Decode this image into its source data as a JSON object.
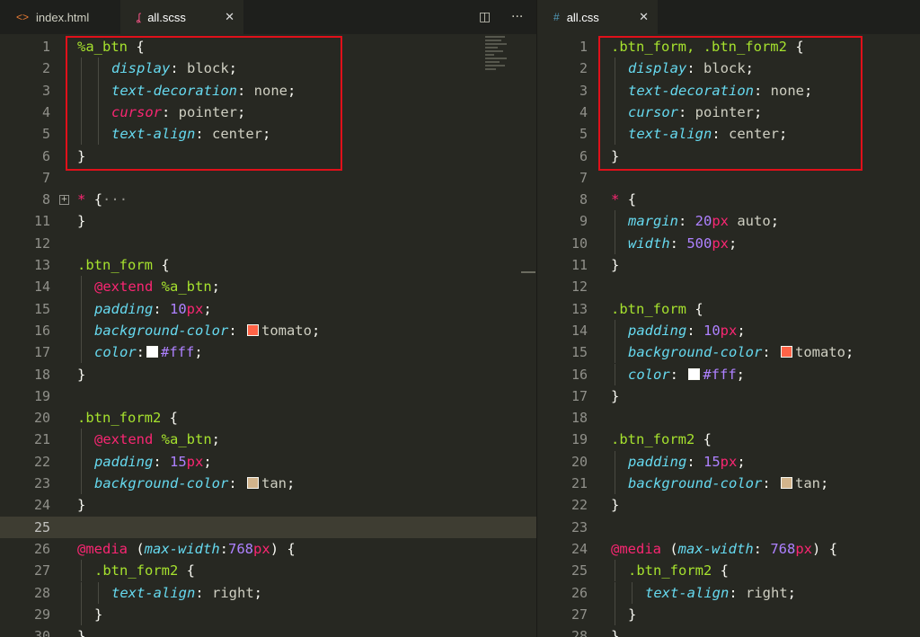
{
  "tabs": {
    "left": [
      {
        "label": "index.html",
        "icon": "html-icon",
        "icon_glyph": "<>",
        "icon_color": "#e37933"
      },
      {
        "label": "all.scss",
        "icon": "sass-icon",
        "icon_glyph": "ʆ",
        "icon_color": "#f55385",
        "close": "✕"
      }
    ],
    "right": [
      {
        "label": "all.css",
        "icon": "css-icon",
        "icon_glyph": "#",
        "icon_color": "#519aba",
        "close": "✕"
      }
    ],
    "split_button": "◫",
    "more_button": "···"
  },
  "colors": {
    "background": "#272822",
    "tomato": "#ff6347",
    "white": "#ffffff",
    "tan": "#d2b48c",
    "highlight_box": "#e0101a"
  },
  "left_lines": [
    {
      "n": "1",
      "parts": [
        [
          "sel",
          "%a_btn"
        ],
        [
          "pun",
          " "
        ],
        [
          "brace",
          "{"
        ]
      ]
    },
    {
      "n": "2",
      "indent": 2,
      "parts": [
        [
          "pr",
          "display"
        ],
        [
          "pun",
          ": "
        ],
        [
          "val",
          "block"
        ],
        [
          "pun",
          ";"
        ]
      ]
    },
    {
      "n": "3",
      "indent": 2,
      "parts": [
        [
          "pr",
          "text-decoration"
        ],
        [
          "pun",
          ": "
        ],
        [
          "val",
          "none"
        ],
        [
          "pun",
          ";"
        ]
      ]
    },
    {
      "n": "4",
      "indent": 2,
      "parts": [
        [
          "prr",
          "cursor"
        ],
        [
          "pun",
          ": "
        ],
        [
          "val",
          "pointer"
        ],
        [
          "pun",
          ";"
        ]
      ]
    },
    {
      "n": "5",
      "indent": 2,
      "parts": [
        [
          "pr",
          "text-align"
        ],
        [
          "pun",
          ": "
        ],
        [
          "val",
          "center"
        ],
        [
          "pun",
          ";"
        ]
      ]
    },
    {
      "n": "6",
      "parts": [
        [
          "brace",
          "}"
        ]
      ]
    },
    {
      "n": "7",
      "parts": []
    },
    {
      "n": "8",
      "fold": "+",
      "parts": [
        [
          "star",
          "*"
        ],
        [
          "pun",
          " "
        ],
        [
          "brace",
          "{"
        ],
        [
          "dots",
          "···"
        ]
      ]
    },
    {
      "n": "11",
      "parts": [
        [
          "brace",
          "}"
        ]
      ]
    },
    {
      "n": "12",
      "parts": []
    },
    {
      "n": "13",
      "parts": [
        [
          "sel",
          ".btn_form"
        ],
        [
          "pun",
          " "
        ],
        [
          "brace",
          "{"
        ]
      ]
    },
    {
      "n": "14",
      "indent": 1,
      "parts": [
        [
          "at",
          "@extend"
        ],
        [
          "pun",
          " "
        ],
        [
          "sel",
          "%a_btn"
        ],
        [
          "pun",
          ";"
        ]
      ]
    },
    {
      "n": "15",
      "indent": 1,
      "parts": [
        [
          "pr",
          "padding"
        ],
        [
          "pun",
          ": "
        ],
        [
          "num",
          "10"
        ],
        [
          "unit",
          "px"
        ],
        [
          "pun",
          ";"
        ]
      ]
    },
    {
      "n": "16",
      "indent": 1,
      "parts": [
        [
          "pr",
          "background-color"
        ],
        [
          "pun",
          ": "
        ],
        [
          "swatch",
          "#ff6347"
        ],
        [
          "val",
          "tomato"
        ],
        [
          "pun",
          ";"
        ]
      ]
    },
    {
      "n": "17",
      "indent": 1,
      "parts": [
        [
          "pr",
          "color"
        ],
        [
          "pun",
          ":"
        ],
        [
          "swatch",
          "#ffffff"
        ],
        [
          "num",
          "#fff"
        ],
        [
          "pun",
          ";"
        ]
      ]
    },
    {
      "n": "18",
      "parts": [
        [
          "brace",
          "}"
        ]
      ]
    },
    {
      "n": "19",
      "parts": []
    },
    {
      "n": "20",
      "parts": [
        [
          "sel",
          ".btn_form2"
        ],
        [
          "pun",
          " "
        ],
        [
          "brace",
          "{"
        ]
      ]
    },
    {
      "n": "21",
      "indent": 1,
      "parts": [
        [
          "at",
          "@extend"
        ],
        [
          "pun",
          " "
        ],
        [
          "sel",
          "%a_btn"
        ],
        [
          "pun",
          ";"
        ]
      ]
    },
    {
      "n": "22",
      "indent": 1,
      "parts": [
        [
          "pr",
          "padding"
        ],
        [
          "pun",
          ": "
        ],
        [
          "num",
          "15"
        ],
        [
          "unit",
          "px"
        ],
        [
          "pun",
          ";"
        ]
      ]
    },
    {
      "n": "23",
      "indent": 1,
      "parts": [
        [
          "pr",
          "background-color"
        ],
        [
          "pun",
          ": "
        ],
        [
          "swatch",
          "#d2b48c"
        ],
        [
          "val",
          "tan"
        ],
        [
          "pun",
          ";"
        ]
      ]
    },
    {
      "n": "24",
      "parts": [
        [
          "brace",
          "}"
        ]
      ]
    },
    {
      "n": "25",
      "current": true,
      "parts": []
    },
    {
      "n": "26",
      "parts": [
        [
          "at",
          "@media"
        ],
        [
          "pun",
          " ("
        ],
        [
          "pr",
          "max-width"
        ],
        [
          "pun",
          ":"
        ],
        [
          "num",
          "768"
        ],
        [
          "unit",
          "px"
        ],
        [
          "pun",
          ") "
        ],
        [
          "brace",
          "{"
        ]
      ]
    },
    {
      "n": "27",
      "indent": 1,
      "parts": [
        [
          "sel",
          ".btn_form2"
        ],
        [
          "pun",
          " "
        ],
        [
          "brace",
          "{"
        ]
      ]
    },
    {
      "n": "28",
      "indent": 2,
      "parts": [
        [
          "pr",
          "text-align"
        ],
        [
          "pun",
          ": "
        ],
        [
          "val",
          "right"
        ],
        [
          "pun",
          ";"
        ]
      ]
    },
    {
      "n": "29",
      "indent": 1,
      "parts": [
        [
          "brace",
          "}"
        ]
      ]
    },
    {
      "n": "30",
      "parts": [
        [
          "brace",
          "}"
        ]
      ]
    }
  ],
  "right_lines": [
    {
      "n": "1",
      "parts": [
        [
          "sel",
          ".btn_form, .btn_form2"
        ],
        [
          "pun",
          " "
        ],
        [
          "brace",
          "{"
        ]
      ]
    },
    {
      "n": "2",
      "indent": 1,
      "parts": [
        [
          "pr",
          "display"
        ],
        [
          "pun",
          ": "
        ],
        [
          "val",
          "block"
        ],
        [
          "pun",
          ";"
        ]
      ]
    },
    {
      "n": "3",
      "indent": 1,
      "parts": [
        [
          "pr",
          "text-decoration"
        ],
        [
          "pun",
          ": "
        ],
        [
          "val",
          "none"
        ],
        [
          "pun",
          ";"
        ]
      ]
    },
    {
      "n": "4",
      "indent": 1,
      "parts": [
        [
          "pr",
          "cursor"
        ],
        [
          "pun",
          ": "
        ],
        [
          "val",
          "pointer"
        ],
        [
          "pun",
          ";"
        ]
      ]
    },
    {
      "n": "5",
      "indent": 1,
      "parts": [
        [
          "pr",
          "text-align"
        ],
        [
          "pun",
          ": "
        ],
        [
          "val",
          "center"
        ],
        [
          "pun",
          ";"
        ]
      ]
    },
    {
      "n": "6",
      "parts": [
        [
          "brace",
          "}"
        ]
      ]
    },
    {
      "n": "7",
      "parts": []
    },
    {
      "n": "8",
      "parts": [
        [
          "star",
          "*"
        ],
        [
          "pun",
          " "
        ],
        [
          "brace",
          "{"
        ]
      ]
    },
    {
      "n": "9",
      "indent": 1,
      "parts": [
        [
          "pr",
          "margin"
        ],
        [
          "pun",
          ": "
        ],
        [
          "num",
          "20"
        ],
        [
          "unit",
          "px"
        ],
        [
          "val",
          " auto"
        ],
        [
          "pun",
          ";"
        ]
      ]
    },
    {
      "n": "10",
      "indent": 1,
      "parts": [
        [
          "pr",
          "width"
        ],
        [
          "pun",
          ": "
        ],
        [
          "num",
          "500"
        ],
        [
          "unit",
          "px"
        ],
        [
          "pun",
          ";"
        ]
      ]
    },
    {
      "n": "11",
      "parts": [
        [
          "brace",
          "}"
        ]
      ]
    },
    {
      "n": "12",
      "parts": []
    },
    {
      "n": "13",
      "parts": [
        [
          "sel",
          ".btn_form"
        ],
        [
          "pun",
          " "
        ],
        [
          "brace",
          "{"
        ]
      ]
    },
    {
      "n": "14",
      "indent": 1,
      "parts": [
        [
          "pr",
          "padding"
        ],
        [
          "pun",
          ": "
        ],
        [
          "num",
          "10"
        ],
        [
          "unit",
          "px"
        ],
        [
          "pun",
          ";"
        ]
      ]
    },
    {
      "n": "15",
      "indent": 1,
      "parts": [
        [
          "pr",
          "background-color"
        ],
        [
          "pun",
          ": "
        ],
        [
          "swatch",
          "#ff6347"
        ],
        [
          "val",
          "tomato"
        ],
        [
          "pun",
          ";"
        ]
      ]
    },
    {
      "n": "16",
      "indent": 1,
      "parts": [
        [
          "pr",
          "color"
        ],
        [
          "pun",
          ": "
        ],
        [
          "swatch",
          "#ffffff"
        ],
        [
          "num",
          "#fff"
        ],
        [
          "pun",
          ";"
        ]
      ]
    },
    {
      "n": "17",
      "parts": [
        [
          "brace",
          "}"
        ]
      ]
    },
    {
      "n": "18",
      "parts": []
    },
    {
      "n": "19",
      "parts": [
        [
          "sel",
          ".btn_form2"
        ],
        [
          "pun",
          " "
        ],
        [
          "brace",
          "{"
        ]
      ]
    },
    {
      "n": "20",
      "indent": 1,
      "parts": [
        [
          "pr",
          "padding"
        ],
        [
          "pun",
          ": "
        ],
        [
          "num",
          "15"
        ],
        [
          "unit",
          "px"
        ],
        [
          "pun",
          ";"
        ]
      ]
    },
    {
      "n": "21",
      "indent": 1,
      "parts": [
        [
          "pr",
          "background-color"
        ],
        [
          "pun",
          ": "
        ],
        [
          "swatch",
          "#d2b48c"
        ],
        [
          "val",
          "tan"
        ],
        [
          "pun",
          ";"
        ]
      ]
    },
    {
      "n": "22",
      "parts": [
        [
          "brace",
          "}"
        ]
      ]
    },
    {
      "n": "23",
      "parts": []
    },
    {
      "n": "24",
      "parts": [
        [
          "at",
          "@media"
        ],
        [
          "pun",
          " ("
        ],
        [
          "pr",
          "max-width"
        ],
        [
          "pun",
          ": "
        ],
        [
          "num",
          "768"
        ],
        [
          "unit",
          "px"
        ],
        [
          "pun",
          ") "
        ],
        [
          "brace",
          "{"
        ]
      ]
    },
    {
      "n": "25",
      "indent": 1,
      "parts": [
        [
          "sel",
          ".btn_form2"
        ],
        [
          "pun",
          " "
        ],
        [
          "brace",
          "{"
        ]
      ]
    },
    {
      "n": "26",
      "indent": 2,
      "parts": [
        [
          "pr",
          "text-align"
        ],
        [
          "pun",
          ": "
        ],
        [
          "val",
          "right"
        ],
        [
          "pun",
          ";"
        ]
      ]
    },
    {
      "n": "27",
      "indent": 1,
      "parts": [
        [
          "brace",
          "}"
        ]
      ]
    },
    {
      "n": "28",
      "parts": [
        [
          "brace",
          "}"
        ]
      ]
    }
  ]
}
